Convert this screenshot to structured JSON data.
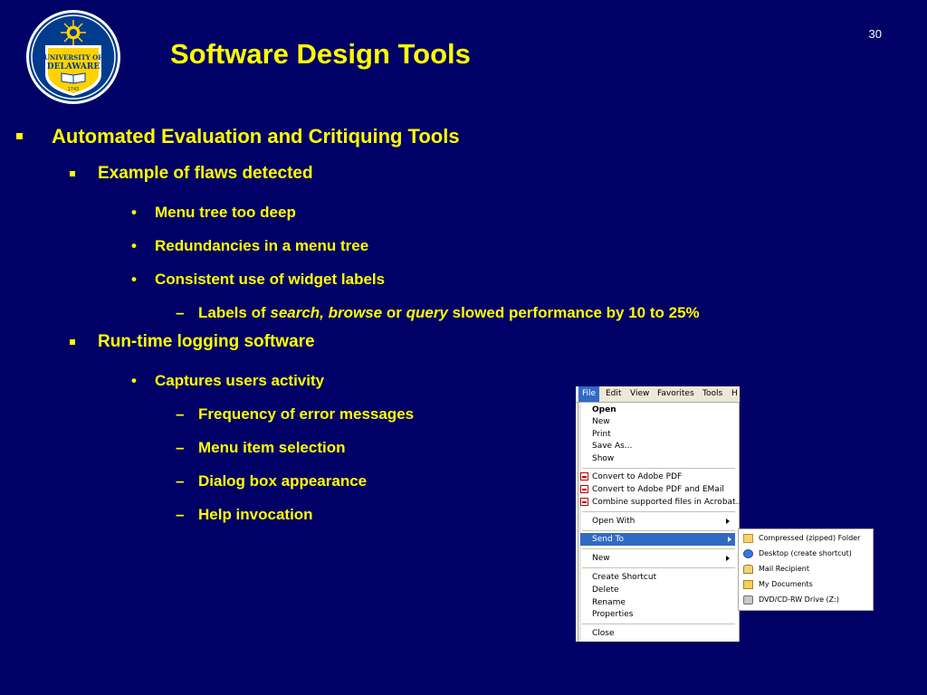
{
  "slide": {
    "title": "Software Design Tools",
    "number": "30",
    "logo": {
      "text_top": "UNIVERSITY OF",
      "text_bottom": "DELAWARE",
      "year": "1743",
      "colors": {
        "blue": "#003b8e",
        "gold": "#ffd200"
      }
    }
  },
  "bullets": {
    "b1": "Automated Evaluation and Critiquing Tools",
    "b1_1": "Example of flaws detected",
    "b1_1_1": "Menu tree too deep",
    "b1_1_2": "Redundancies in a menu tree",
    "b1_1_3": "Consistent use of widget labels",
    "b1_1_3_1": {
      "pre": "Labels of ",
      "em1": "search, browse",
      "mid": " or ",
      "em2": "query",
      "post": " slowed performance by 10 to 25%"
    },
    "b1_2": "Run-time logging software",
    "b1_2_1": "Captures users activity",
    "b1_2_1_1": "Frequency of error messages",
    "b1_2_1_2": "Menu item selection",
    "b1_2_1_3": "Dialog box appearance",
    "b1_2_1_4": "Help invocation"
  },
  "menu_screenshot": {
    "menubar": [
      "File",
      "Edit",
      "View",
      "Favorites",
      "Tools",
      "H"
    ],
    "items": {
      "open": "Open",
      "new": "New",
      "print": "Print",
      "save_as": "Save As...",
      "show": "Show",
      "convert_pdf": "Convert to Adobe PDF",
      "convert_pdf_email": "Convert to Adobe PDF and EMail",
      "combine": "Combine supported files in Acrobat...",
      "open_with": "Open With",
      "send_to": "Send To",
      "new2": "New",
      "create_shortcut": "Create Shortcut",
      "delete": "Delete",
      "rename": "Rename",
      "properties": "Properties",
      "close": "Close"
    },
    "send_to_submenu": [
      "Compressed (zipped) Folder",
      "Desktop (create shortcut)",
      "Mail Recipient",
      "My Documents",
      "DVD/CD-RW Drive (Z:)"
    ]
  }
}
